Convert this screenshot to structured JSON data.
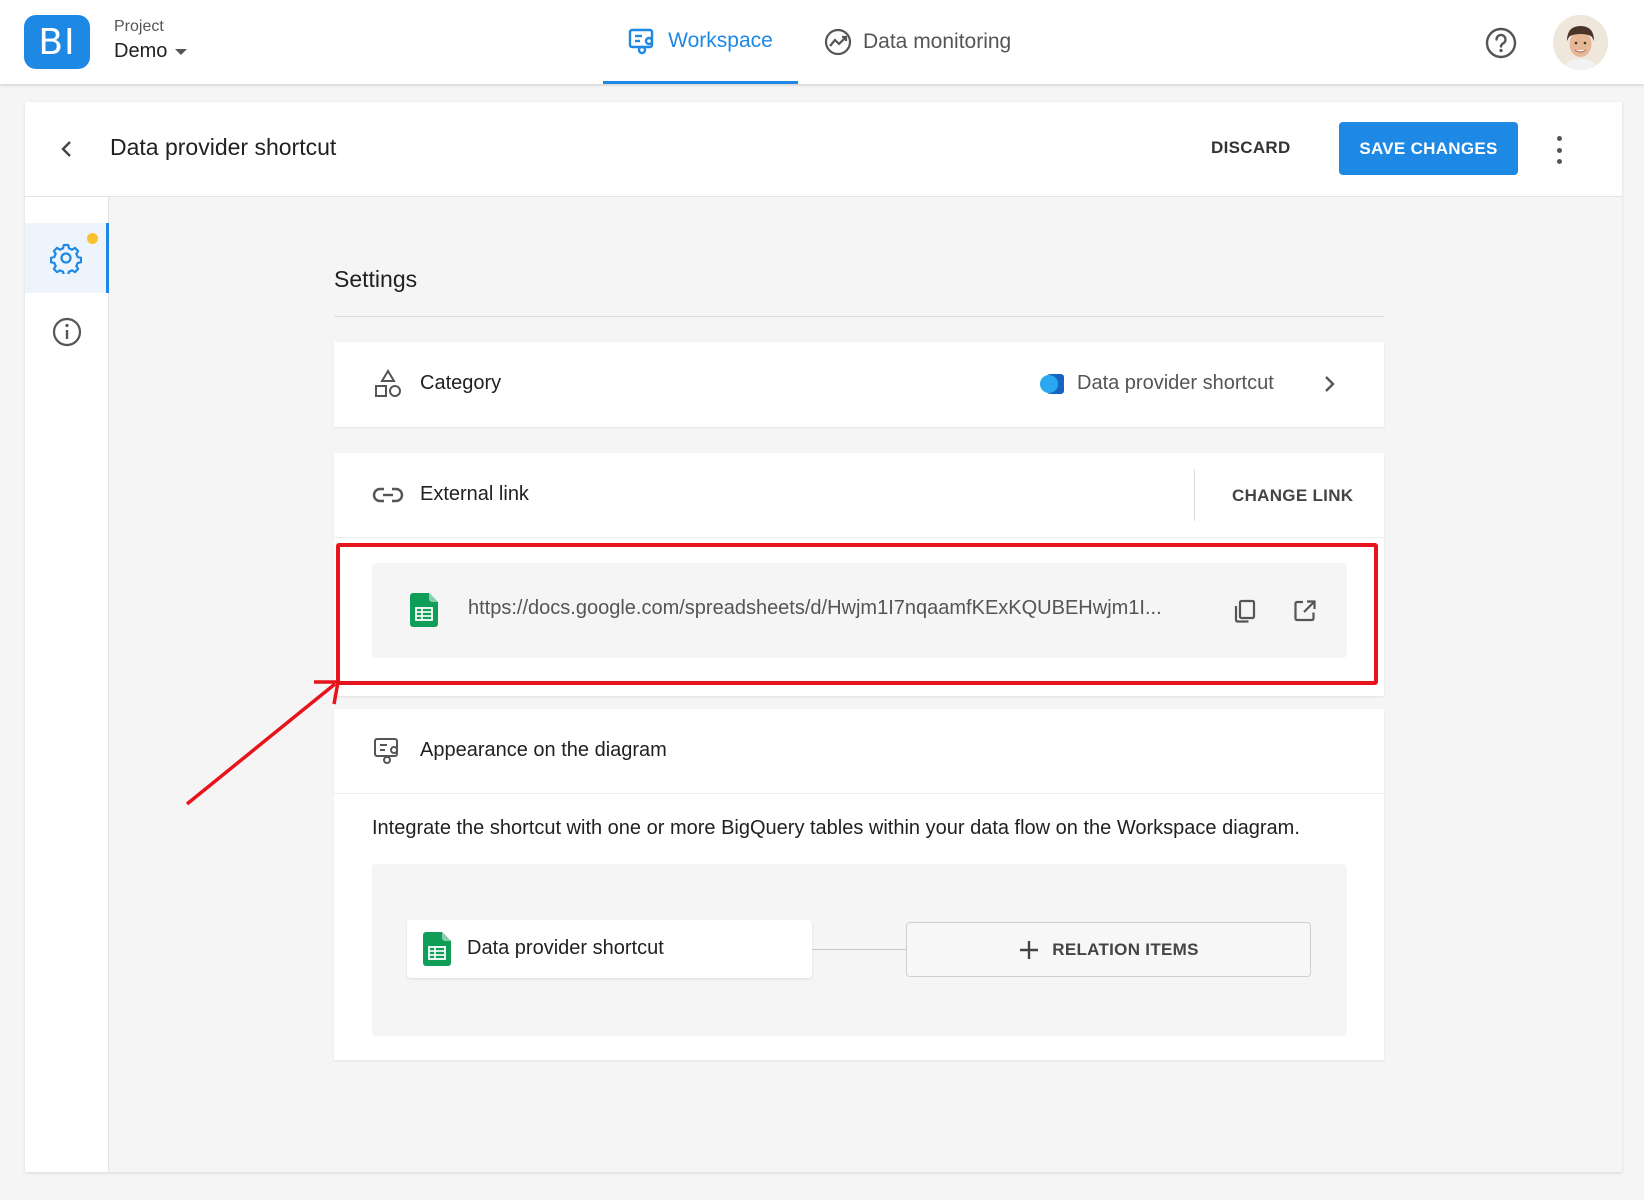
{
  "topbar": {
    "logo_text": "BI",
    "project_caption": "Project",
    "project_name": "Demo",
    "tabs": [
      {
        "label": "Workspace",
        "active": true
      },
      {
        "label": "Data monitoring",
        "active": false
      }
    ],
    "help_icon": "question-circle-icon",
    "avatar_icon": "user-avatar"
  },
  "header": {
    "title": "Data provider shortcut",
    "discard_label": "DISCARD",
    "save_label": "SAVE CHANGES"
  },
  "sidebar": {
    "items": [
      {
        "icon": "gear-icon",
        "active": true,
        "has_badge": true
      },
      {
        "icon": "info-icon",
        "active": false
      }
    ]
  },
  "settings": {
    "title": "Settings",
    "category": {
      "label": "Category",
      "value": "Data provider shortcut"
    },
    "external_link": {
      "label": "External link",
      "change_label": "CHANGE LINK",
      "url": "https://docs.google.com/spreadsheets/d/Hwjm1I7nqaamfKExKQUBEHwjm1I..."
    },
    "appearance": {
      "label": "Appearance on the diagram",
      "description": "Integrate the shortcut with one or more BigQuery tables within your data flow on the Workspace diagram.",
      "node_label": "Data provider shortcut",
      "relation_label": "RELATION ITEMS"
    }
  },
  "colors": {
    "accent": "#1e88e5",
    "badge": "#fbc02d",
    "annotation": "#e8141c",
    "sheets_green": "#0f9d58"
  }
}
